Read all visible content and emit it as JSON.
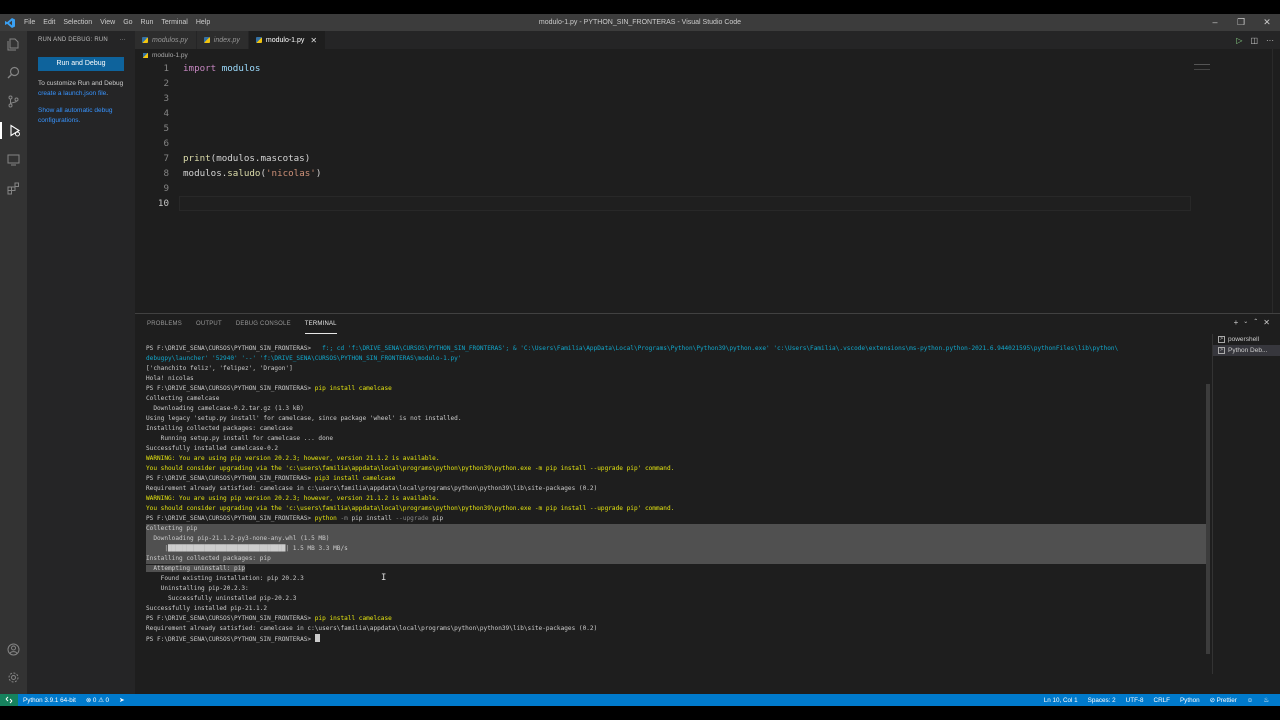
{
  "titlebar": {
    "menu": [
      "File",
      "Edit",
      "Selection",
      "View",
      "Go",
      "Run",
      "Terminal",
      "Help"
    ],
    "title": "modulo-1.py - PYTHON_SIN_FRONTERAS - Visual Studio Code"
  },
  "sidebar": {
    "header": "RUN AND DEBUG: RUN",
    "run_button": "Run and Debug",
    "customize_text": "To customize Run and Debug ",
    "customize_link": "create a launch.json file",
    "customize_end": ".",
    "auto_link": "Show all automatic debug configurations."
  },
  "tabs": [
    {
      "label": "modulos.py",
      "active": false
    },
    {
      "label": "index.py",
      "active": false
    },
    {
      "label": "modulo-1.py",
      "active": true
    }
  ],
  "breadcrumb": "modulo-1.py",
  "code": {
    "line_numbers": [
      "1",
      "2",
      "3",
      "4",
      "5",
      "6",
      "7",
      "8",
      "9",
      "10"
    ],
    "l1_kw": "import",
    "l1_rest": " modulos",
    "l7_fn": "print",
    "l7_rest": "(modulos.mascotas)",
    "l8_a": "modulos.",
    "l8_fn": "saludo",
    "l8_b": "(",
    "l8_str": "'nicolas'",
    "l8_c": ")"
  },
  "panel": {
    "tabs": [
      "PROBLEMS",
      "OUTPUT",
      "DEBUG CONSOLE",
      "TERMINAL"
    ],
    "active_tab": "TERMINAL",
    "terminals": [
      "powershell",
      "Python Deb..."
    ]
  },
  "terminal": {
    "l1_prompt": "PS F:\\DRIVE_SENA\\CURSOS\\PYTHON_SIN_FRONTERAS> ",
    "l1_cmd": " f:; cd 'f:\\DRIVE_SENA\\CURSOS\\PYTHON_SIN_FRONTERAS'; & 'C:\\Users\\Familia\\AppData\\Local\\Programs\\Python\\Python39\\python.exe' 'c:\\Users\\Familia\\.vscode\\extensions\\ms-python.python-2021.6.944021595\\pythonFiles\\lib\\python\\",
    "l2": "debugpy\\launcher' '52940' '--' 'f:\\DRIVE_SENA\\CURSOS\\PYTHON_SIN_FRONTERAS\\modulo-1.py'",
    "l3": "['chanchito feliz', 'felipez', 'Dragon']",
    "l4": "Hola! nicolas",
    "l5_prompt": "PS F:\\DRIVE_SENA\\CURSOS\\PYTHON_SIN_FRONTERAS> ",
    "l5_cmd": "pip install camelcase",
    "l6": "Collecting camelcase",
    "l7": "  Downloading camelcase-0.2.tar.gz (1.3 kB)",
    "l8": "Using legacy 'setup.py install' for camelcase, since package 'wheel' is not installed.",
    "l9": "Installing collected packages: camelcase",
    "l10": "    Running setup.py install for camelcase ... done",
    "l11": "Successfully installed camelcase-0.2",
    "l12": "WARNING: You are using pip version 20.2.3; however, version 21.1.2 is available.",
    "l13": "You should consider upgrading via the 'c:\\users\\familia\\appdata\\local\\programs\\python\\python39\\python.exe -m pip install --upgrade pip' command.",
    "l14_prompt": "PS F:\\DRIVE_SENA\\CURSOS\\PYTHON_SIN_FRONTERAS> ",
    "l14_cmd": "pip3 install camelcase",
    "l15": "Requirement already satisfied: camelcase in c:\\users\\familia\\appdata\\local\\programs\\python\\python39\\lib\\site-packages (0.2)",
    "l16": "WARNING: You are using pip version 20.2.3; however, version 21.1.2 is available.",
    "l17": "You should consider upgrading via the 'c:\\users\\familia\\appdata\\local\\programs\\python\\python39\\python.exe -m pip install --upgrade pip' command.",
    "l18_prompt": "PS F:\\DRIVE_SENA\\CURSOS\\PYTHON_SIN_FRONTERAS> ",
    "l18_cmd_a": "python",
    "l18_cmd_b": " -m ",
    "l18_cmd_c": "pip install ",
    "l18_cmd_d": "--upgrade",
    "l18_cmd_e": " pip",
    "l19": "Collecting pip",
    "l20": "  Downloading pip-21.1.2-py3-none-any.whl (1.5 MB)",
    "l21_bar": "     |████████████████████████████████|",
    "l21_rest": " 1.5 MB 3.3 MB/s",
    "l22": "Installing collected packages: pip",
    "l23": "  Attempting uninstall: pip",
    "l24": "    Found existing installation: pip 20.2.3",
    "l25": "    Uninstalling pip-20.2.3:",
    "l26": "      Successfully uninstalled pip-20.2.3",
    "l27": "Successfully installed pip-21.1.2",
    "l28_prompt": "PS F:\\DRIVE_SENA\\CURSOS\\PYTHON_SIN_FRONTERAS> ",
    "l28_cmd": "pip install camelcase",
    "l29": "Requirement already satisfied: camelcase in c:\\users\\familia\\appdata\\local\\programs\\python\\python39\\lib\\site-packages (0.2)",
    "l30_prompt": "PS F:\\DRIVE_SENA\\CURSOS\\PYTHON_SIN_FRONTERAS> "
  },
  "statusbar": {
    "python": "Python 3.9.1 64-bit",
    "problems": "⊗ 0 ⚠ 0",
    "position": "Ln 10, Col 1",
    "spaces": "Spaces: 2",
    "encoding": "UTF-8",
    "eol": "CRLF",
    "language": "Python",
    "prettier": "⊘ Prettier"
  },
  "colors": {
    "accent": "#007acc",
    "button": "#0e639c",
    "warning": "#e5e510"
  }
}
